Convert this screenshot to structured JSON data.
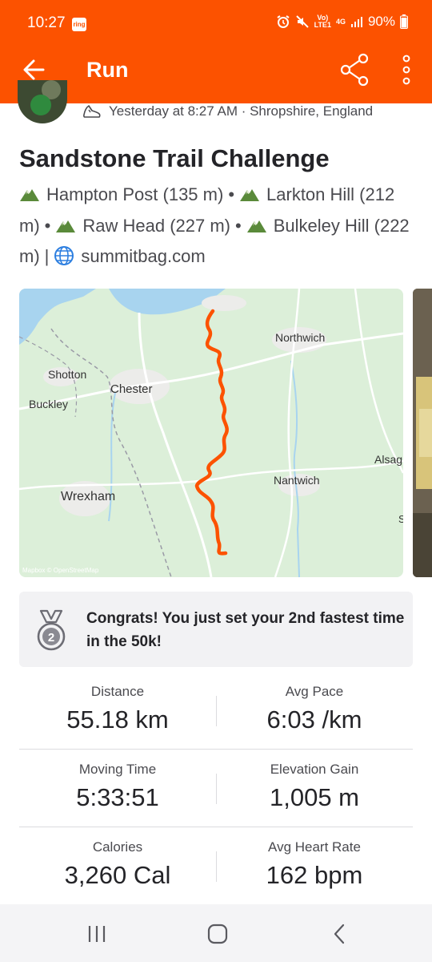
{
  "status_bar": {
    "time": "10:27",
    "ring_badge": "ring",
    "network_top": "Vo)",
    "network_bottom": "LTE1",
    "signal_type": "4G",
    "battery": "90%",
    "icons": [
      "alarm-icon",
      "mute-icon",
      "signal-icon",
      "battery-icon"
    ]
  },
  "app_bar": {
    "title": "Run",
    "icons": [
      "back-arrow-icon",
      "share-icon",
      "more-vert-icon"
    ]
  },
  "activity": {
    "meta": "Yesterday at 8:27 AM · Shropshire, England",
    "title": "Sandstone Trail Challenge",
    "summits": [
      {
        "name": "Hampton Post (135 m)"
      },
      {
        "name": "Larkton Hill (212 m)"
      },
      {
        "name": "Raw Head (227 m)"
      },
      {
        "name": "Bulkeley Hill (222 m)"
      }
    ],
    "separator": "•",
    "pipe": "|",
    "link": "summitbag.com"
  },
  "map": {
    "labels": {
      "northwich": "Northwich",
      "shotton": "Shotton",
      "chester": "Chester",
      "buckley": "Buckley",
      "alsager": "Alsag",
      "nantwich": "Nantwich",
      "wrexham": "Wrexham",
      "attribution": "Mapbox © OpenStreetMap",
      "edge_s": "S"
    },
    "route_color": "#fc5200"
  },
  "achievement": {
    "text": "Congrats! You just set your 2nd fastest time in the 50k!",
    "medal_rank": "2"
  },
  "stats": [
    {
      "label": "Distance",
      "value": "55.18 km"
    },
    {
      "label": "Avg Pace",
      "value": "6:03 /km"
    },
    {
      "label": "Moving Time",
      "value": "5:33:51"
    },
    {
      "label": "Elevation Gain",
      "value": "1,005 m"
    },
    {
      "label": "Calories",
      "value": "3,260 Cal"
    },
    {
      "label": "Avg Heart Rate",
      "value": "162 bpm"
    }
  ],
  "nav_bar": {
    "icons": [
      "recents-icon",
      "home-icon",
      "back-icon"
    ]
  },
  "colors": {
    "brand": "#fc5200",
    "text": "#242428",
    "muted": "#4a4a4f",
    "card_bg": "#f2f2f4",
    "link_icon": "#2d7fe0"
  }
}
